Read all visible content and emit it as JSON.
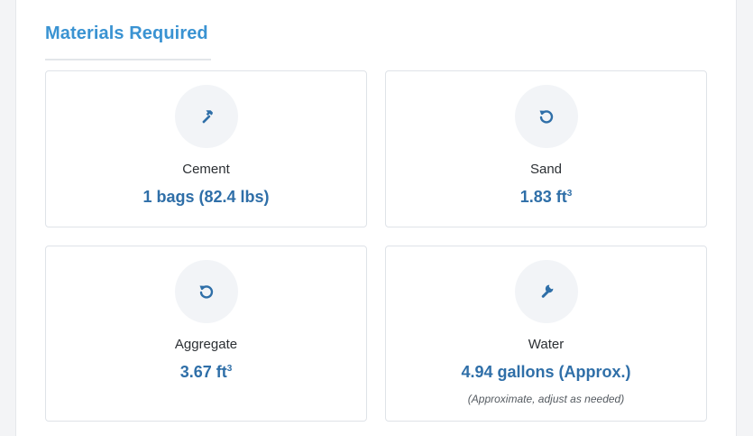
{
  "section": {
    "title": "Materials Required"
  },
  "colors": {
    "accent": "#3a93d2",
    "value": "#2f6fa8",
    "icon": "#2f6fa8",
    "icon_bg": "#f2f4f7"
  },
  "materials": [
    {
      "label": "Cement",
      "value": "1 bags (82.4 lbs)",
      "unit_sup": "",
      "icon": "hammer-icon"
    },
    {
      "label": "Sand",
      "value": "1.83 ft",
      "unit_sup": "3",
      "icon": "rotate-ccw-icon"
    },
    {
      "label": "Aggregate",
      "value": "3.67 ft",
      "unit_sup": "3",
      "icon": "rotate-ccw-icon"
    },
    {
      "label": "Water",
      "value": "4.94 gallons (Approx.)",
      "unit_sup": "",
      "icon": "wrench-icon",
      "note": "(Approximate, adjust as needed)"
    }
  ]
}
